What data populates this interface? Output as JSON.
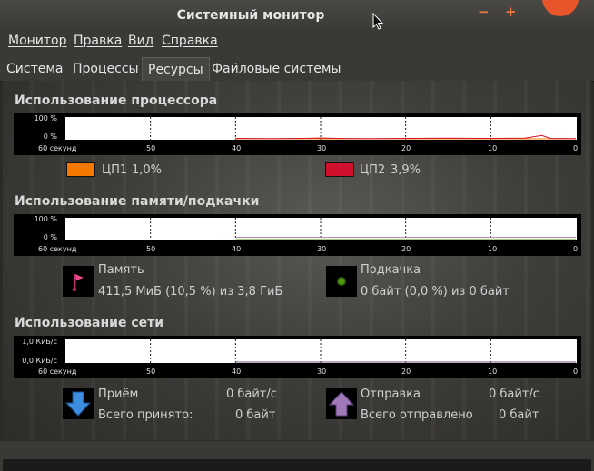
{
  "window": {
    "title": "Системный монитор",
    "min_label": "−",
    "max_label": "+"
  },
  "menu": [
    "Монитор",
    "Правка",
    "Вид",
    "Справка"
  ],
  "tabs": [
    "Система",
    "Процессы",
    "Ресурсы",
    "Файловые системы"
  ],
  "cpu": {
    "title": "Использование процессора",
    "y_labels": [
      "100 %",
      "0 %"
    ],
    "cores": [
      {
        "label": "ЦП1",
        "value": "1,0%",
        "color": "#f57900"
      },
      {
        "label": "ЦП2",
        "value": "3,9%",
        "color": "#d0102c"
      }
    ]
  },
  "memory": {
    "title": "Использование памяти/подкачки",
    "y_labels": [
      "100 %",
      "0 %"
    ],
    "ram_label": "Память",
    "ram_value": "411,5 МиБ (10,5 %) из 3,8 ГиБ",
    "swap_label": "Подкачка",
    "swap_value": "0 байт (0,0 %) из 0 байт"
  },
  "network": {
    "title": "Использование сети",
    "y_labels": [
      "1,0 КиБ/с",
      "0,0 КиБ/с"
    ],
    "rx_label": "Приём",
    "rx_value": "0 байт/с",
    "rx_total_label": "Всего принято:",
    "rx_total_value": "0 байт",
    "tx_label": "Отправка",
    "tx_value": "0 байт/с",
    "tx_total_label": "Всего отправлено",
    "tx_total_value": "0 байт"
  },
  "x_axis": [
    "60 секунд",
    "50",
    "40",
    "30",
    "20",
    "10",
    "0"
  ],
  "chart_data": [
    {
      "type": "line",
      "series": [
        {
          "name": "ЦП1",
          "color": "#f57900",
          "x": [
            40,
            30,
            20,
            10,
            0
          ],
          "values": [
            0,
            0,
            0,
            0,
            0
          ]
        },
        {
          "name": "ЦП2",
          "color": "#d0102c",
          "x": [
            40,
            36,
            32,
            30,
            28,
            24,
            20,
            15,
            10,
            6,
            4,
            3,
            0
          ],
          "values": [
            2,
            1,
            2,
            4,
            2,
            1,
            2,
            3,
            2,
            3,
            16,
            2,
            1
          ]
        }
      ],
      "xlim": [
        60,
        0
      ],
      "ylim": [
        0,
        100
      ]
    },
    {
      "type": "line",
      "series": [
        {
          "name": "Память",
          "color": "#ad7fa8",
          "x": [
            40,
            0
          ],
          "values": [
            10.5,
            10.5
          ]
        },
        {
          "name": "Подкачка",
          "color": "#4e9a06",
          "x": [
            40,
            0
          ],
          "values": [
            0,
            0
          ]
        }
      ],
      "xlim": [
        60,
        0
      ],
      "ylim": [
        0,
        100
      ]
    },
    {
      "type": "line",
      "series": [
        {
          "name": "Приём",
          "color": "#204a87",
          "x": [
            40,
            0
          ],
          "values": [
            0,
            0
          ]
        },
        {
          "name": "Отправка",
          "color": "#75507b",
          "x": [
            40,
            0
          ],
          "values": [
            0,
            0
          ]
        }
      ],
      "xlim": [
        60,
        0
      ],
      "ylim": [
        0,
        1
      ]
    }
  ]
}
